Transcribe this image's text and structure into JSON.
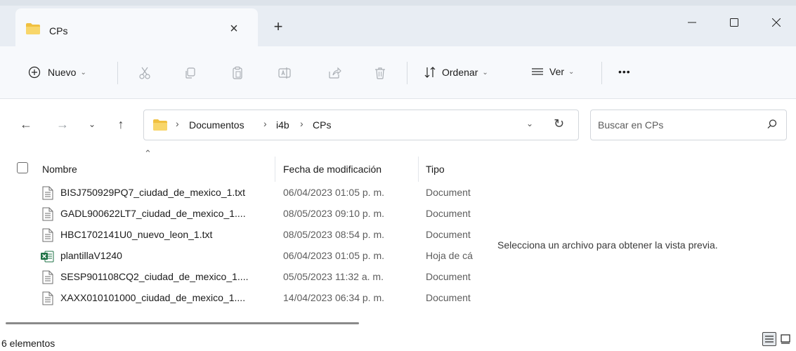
{
  "tab": {
    "title": "CPs",
    "close_label": "×",
    "new_tab_label": "+"
  },
  "commands": {
    "new_label": "Nuevo",
    "sort_label": "Ordenar",
    "view_label": "Ver",
    "more_label": "•••"
  },
  "breadcrumb": [
    "Documentos",
    "i4b",
    "CPs"
  ],
  "search": {
    "placeholder": "Buscar en CPs"
  },
  "columns": {
    "name": "Nombre",
    "date": "Fecha de modificación",
    "type": "Tipo"
  },
  "files": [
    {
      "name": "BISJ750929PQ7_ciudad_de_mexico_1.txt",
      "date": "06/04/2023 01:05 p. m.",
      "type": "Document",
      "icon": "text-file-icon"
    },
    {
      "name": "GADL900622LT7_ciudad_de_mexico_1....",
      "date": "08/05/2023 09:10 p. m.",
      "type": "Document",
      "icon": "text-file-icon"
    },
    {
      "name": "HBC1702141U0_nuevo_leon_1.txt",
      "date": "08/05/2023 08:54 p. m.",
      "type": "Document",
      "icon": "text-file-icon"
    },
    {
      "name": "plantillaV1240",
      "date": "06/04/2023 01:05 p. m.",
      "type": "Hoja de cá",
      "icon": "excel-file-icon"
    },
    {
      "name": "SESP901108CQ2_ciudad_de_mexico_1....",
      "date": "05/05/2023 11:32 a. m.",
      "type": "Document",
      "icon": "text-file-icon"
    },
    {
      "name": "XAXX010101000_ciudad_de_mexico_1....",
      "date": "14/04/2023 06:34 p. m.",
      "type": "Document",
      "icon": "text-file-icon"
    }
  ],
  "preview": {
    "message": "Selecciona un archivo para obtener la vista previa."
  },
  "status": {
    "count": "6 elementos"
  },
  "colors": {
    "folder": "#f0c040",
    "excel": "#1e7145",
    "accent": "#005fb8"
  }
}
